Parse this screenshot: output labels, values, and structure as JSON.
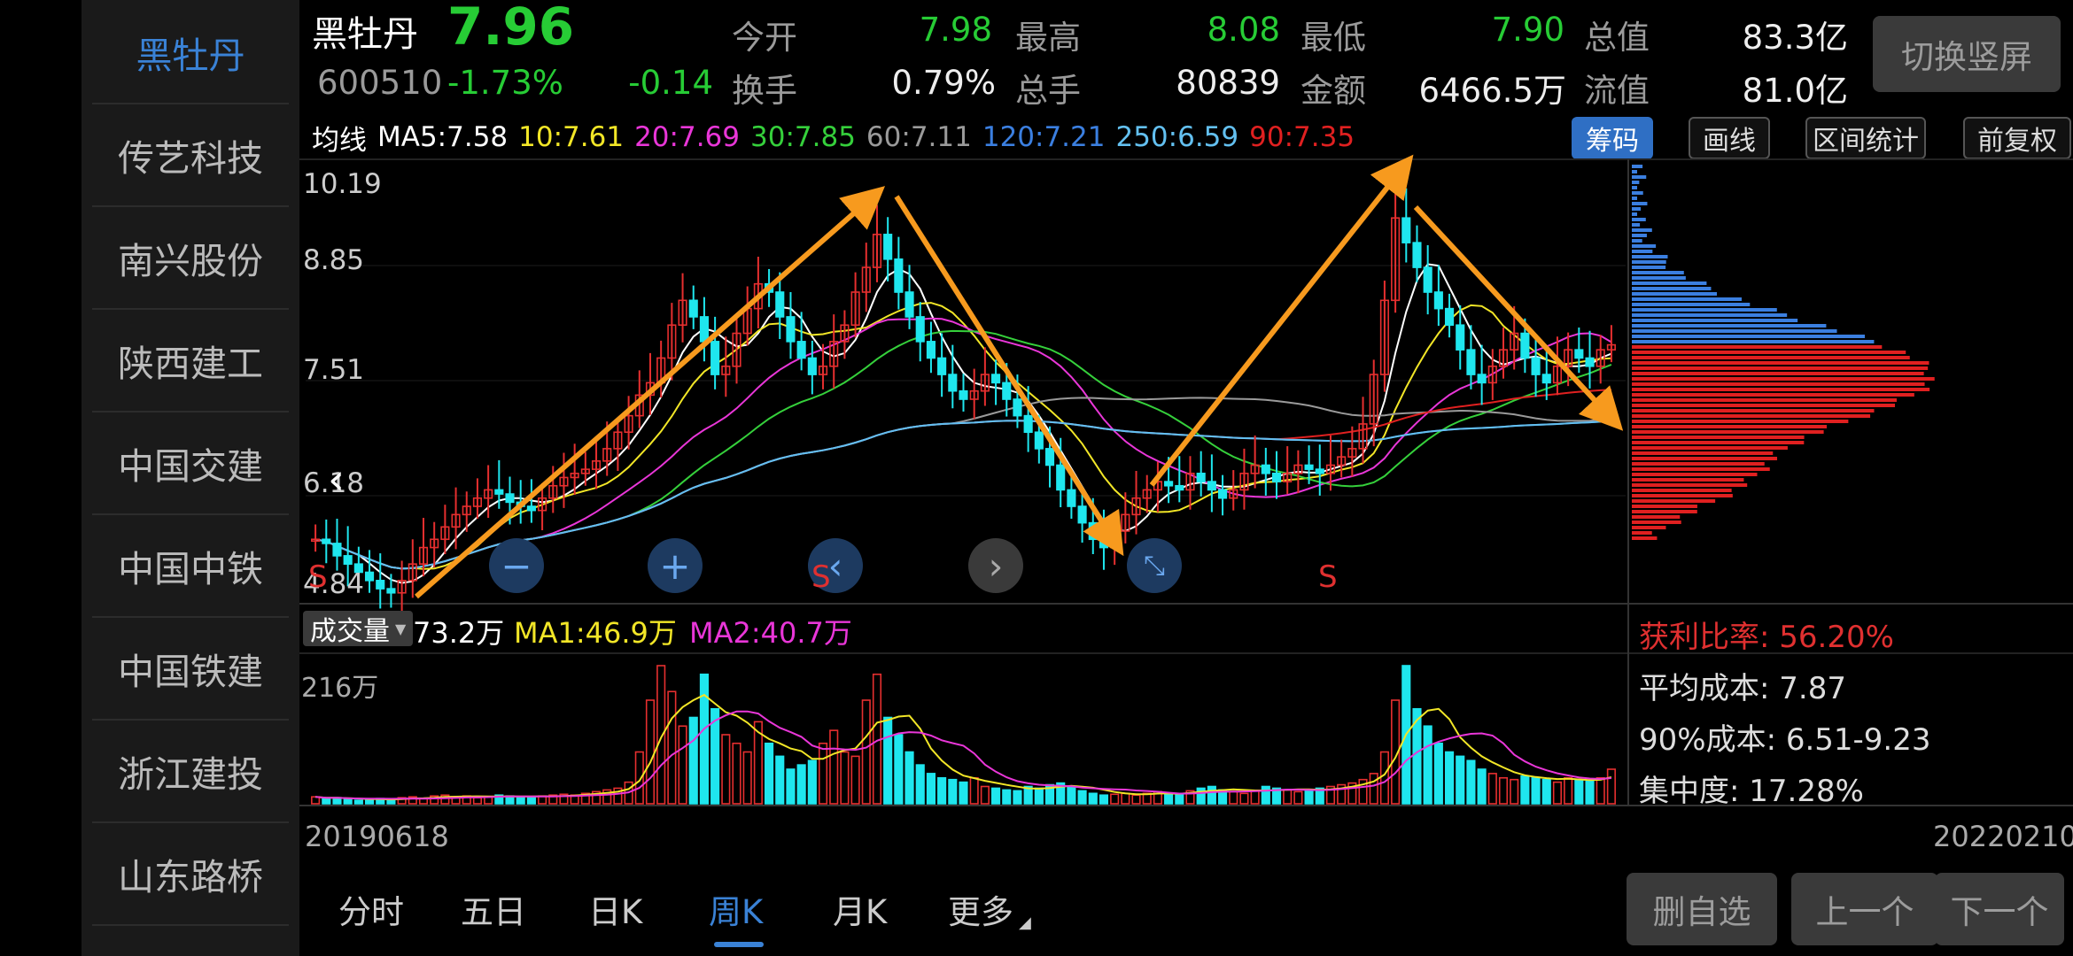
{
  "sidebar": {
    "items": [
      {
        "label": "黑牡丹",
        "active": true
      },
      {
        "label": "传艺科技"
      },
      {
        "label": "南兴股份"
      },
      {
        "label": "陕西建工"
      },
      {
        "label": "中国交建"
      },
      {
        "label": "中国中铁"
      },
      {
        "label": "中国铁建"
      },
      {
        "label": "浙江建投"
      },
      {
        "label": "山东路桥"
      }
    ]
  },
  "header": {
    "name": "黑牡丹",
    "price": "7.96",
    "code": "600510",
    "change_pct": "-1.73%",
    "change": "-0.14",
    "fields": {
      "open_label": "今开",
      "open": "7.98",
      "high_label": "最高",
      "high": "8.08",
      "low_label": "最低",
      "low": "7.90",
      "mcap_label": "总值",
      "mcap": "83.3亿",
      "turnover_label": "换手",
      "turnover": "0.79%",
      "volume_label": "总手",
      "volume": "80839",
      "amount_label": "金额",
      "amount": "6466.5万",
      "float_label": "流值",
      "float": "81.0亿"
    },
    "switch_label": "切换竖屏"
  },
  "ma_row": {
    "title": "均线",
    "items": [
      {
        "text": "MA5:7.58",
        "color": "#ffffff"
      },
      {
        "text": "10:7.61",
        "color": "#f2e627"
      },
      {
        "text": "20:7.69",
        "color": "#e936d8"
      },
      {
        "text": "30:7.85",
        "color": "#35d03b"
      },
      {
        "text": "60:7.11",
        "color": "#9a9a9a"
      },
      {
        "text": "120:7.21",
        "color": "#3b7fe0"
      },
      {
        "text": "250:6.59",
        "color": "#63c0f0"
      },
      {
        "text": "90:7.35",
        "color": "#e02020"
      }
    ],
    "tools": [
      "筹码",
      "画线",
      "区间统计",
      "前复权"
    ]
  },
  "price_axis": [
    "10.19",
    "8.85",
    "7.51",
    "6.18",
    "4.84"
  ],
  "chart_nav": {
    "back_glyph": "‹",
    "minus_glyph": "−",
    "plus_glyph": "+",
    "prev_glyph": "‹",
    "next_glyph": "›"
  },
  "markers": [
    "S",
    "S",
    "S"
  ],
  "volume": {
    "label": "成交量",
    "value": "73.2万",
    "ma1": "MA1:46.9万",
    "ma2": "MA2:40.7万",
    "max_label": "216万"
  },
  "chip_stats": {
    "profit_ratio": "获利比率: 56.20%",
    "avg_cost": "平均成本: 7.87",
    "cost90": "90%成本:  6.51-9.23",
    "concentration": "集中度: 17.28%"
  },
  "dates": {
    "start": "20190618",
    "end": "20220210"
  },
  "periods": [
    "分时",
    "五日",
    "日K",
    "周K",
    "月K",
    "更多"
  ],
  "active_period": "周K",
  "bottom_buttons": [
    "删自选",
    "上一个",
    "下一个"
  ],
  "colors": {
    "up": "#e62f2f",
    "down": "#1fe6ee",
    "accent": "#3a82d6",
    "arrow": "#f79a1e"
  },
  "chart_data": {
    "type": "candlestick",
    "title": "",
    "y_range": [
      4.84,
      10.19
    ],
    "close_series": [
      5.6,
      5.55,
      5.4,
      5.3,
      5.2,
      5.1,
      5.0,
      4.95,
      5.1,
      5.3,
      5.5,
      5.6,
      5.75,
      5.9,
      6.0,
      6.1,
      6.2,
      6.15,
      6.05,
      6.0,
      5.95,
      6.1,
      6.25,
      6.35,
      6.4,
      6.45,
      6.55,
      6.7,
      6.9,
      7.1,
      7.35,
      7.5,
      7.8,
      8.2,
      8.5,
      8.3,
      8.0,
      7.6,
      7.7,
      8.1,
      8.4,
      8.7,
      8.6,
      8.3,
      8.0,
      7.8,
      7.6,
      7.7,
      8.0,
      8.2,
      8.6,
      8.9,
      9.3,
      9.0,
      8.6,
      8.3,
      8.0,
      7.8,
      7.6,
      7.4,
      7.3,
      7.4,
      7.6,
      7.5,
      7.3,
      7.1,
      6.9,
      6.7,
      6.5,
      6.2,
      6.0,
      5.8,
      5.6,
      5.5,
      5.7,
      5.9,
      6.1,
      6.2,
      6.3,
      6.25,
      6.2,
      6.4,
      6.3,
      6.2,
      6.1,
      6.2,
      6.4,
      6.5,
      6.4,
      6.3,
      6.4,
      6.5,
      6.45,
      6.4,
      6.5,
      6.6,
      6.7,
      7.0,
      7.6,
      8.5,
      9.5,
      9.2,
      8.9,
      8.6,
      8.4,
      8.2,
      7.9,
      7.6,
      7.5,
      7.7,
      7.9,
      8.1,
      7.8,
      7.6,
      7.5,
      7.7,
      7.9,
      7.8,
      7.7,
      7.9,
      7.96
    ],
    "volume_series": [
      8,
      6,
      7,
      5,
      4,
      5,
      6,
      5,
      7,
      8,
      6,
      9,
      10,
      8,
      9,
      7,
      8,
      10,
      9,
      8,
      7,
      9,
      10,
      11,
      10,
      12,
      14,
      16,
      18,
      25,
      60,
      120,
      160,
      130,
      90,
      100,
      150,
      110,
      80,
      70,
      60,
      95,
      70,
      55,
      40,
      45,
      50,
      70,
      85,
      60,
      55,
      120,
      150,
      100,
      80,
      60,
      45,
      35,
      30,
      28,
      25,
      30,
      20,
      18,
      16,
      15,
      20,
      18,
      22,
      24,
      20,
      15,
      12,
      10,
      11,
      12,
      10,
      12,
      14,
      12,
      10,
      15,
      18,
      20,
      16,
      14,
      12,
      15,
      20,
      18,
      16,
      14,
      15,
      18,
      20,
      22,
      24,
      28,
      35,
      60,
      120,
      160,
      110,
      90,
      70,
      60,
      55,
      50,
      40,
      35,
      30,
      28,
      32,
      30,
      28,
      25,
      30,
      28,
      26,
      30,
      40
    ],
    "ma_values": {
      "MA5": 7.58,
      "10": 7.61,
      "20": 7.69,
      "30": 7.85,
      "60": 7.11,
      "120": 7.21,
      "250": 6.59,
      "90": 7.35
    },
    "chip_distribution": "profile"
  }
}
